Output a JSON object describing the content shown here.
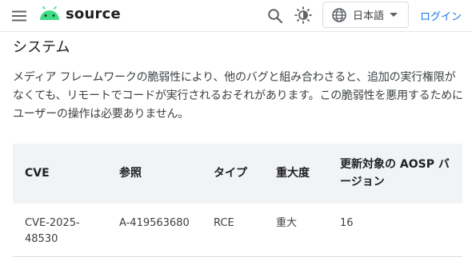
{
  "header": {
    "brand": "source",
    "language": "日本語",
    "login": "ログイン",
    "icons": [
      "menu-icon",
      "android-logo",
      "search-icon",
      "theme-toggle-icon",
      "globe-icon",
      "caret-down-icon"
    ]
  },
  "section": {
    "title": "システム",
    "description": "メディア フレームワークの脆弱性により、他のバグと組み合わさると、追加の実行権限がなくても、リモートでコードが実行されるおそれがあります。この脆弱性を悪用するためにユーザーの操作は必要ありません。"
  },
  "table": {
    "headers": {
      "cve": "CVE",
      "ref": "参照",
      "type": "タイプ",
      "severity": "重大度",
      "aosp": "更新対象の AOSP バージョン"
    },
    "rows": [
      {
        "cve": "CVE-2025-48530",
        "ref": "A-419563680",
        "type": "RCE",
        "severity": "重大",
        "aosp": "16"
      }
    ]
  },
  "colors": {
    "accent": "#1a73e8",
    "android_green": "#3ddc84",
    "header_bg": "#f1f3f4",
    "text": "#202124"
  }
}
